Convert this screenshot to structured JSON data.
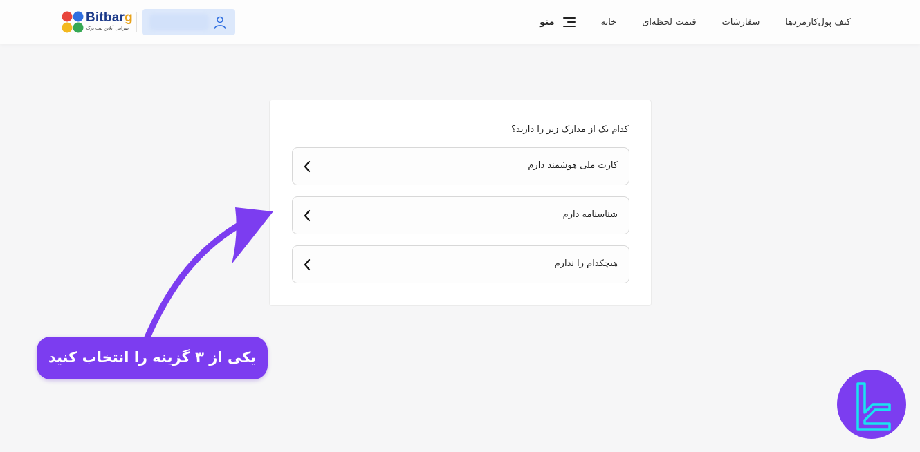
{
  "header": {
    "nav": {
      "menu_label": "منو",
      "links": [
        "خانه",
        "قیمت لحظه‌ای",
        "سفارشات",
        "کارمزدها",
        "کیف پول"
      ]
    },
    "logo": {
      "name_main": "Bitbar",
      "name_accent": "g",
      "tagline": "صرافی آنلاین بیت برگ"
    }
  },
  "card": {
    "question": "کدام یک از مدارک زیر را دارید؟",
    "options": [
      {
        "label": "کارت ملی هوشمند دارم"
      },
      {
        "label": "شناسنامه دارم"
      },
      {
        "label": "هیچکدام را ندارم"
      }
    ]
  },
  "annotation": {
    "callout_text": "یکی از ۳ گزینه را انتخاب کنید"
  },
  "colors": {
    "accent_purple": "#7c3df0",
    "account_blue": "#dce8fb",
    "badge_cyan": "#19e3f0"
  },
  "icons": {
    "menu": "hamburger-icon",
    "user": "user-icon",
    "option_chevron": "chevron-left-icon",
    "arrow": "curved-arrow-icon",
    "badge": "tradingfinder-logo-icon"
  }
}
